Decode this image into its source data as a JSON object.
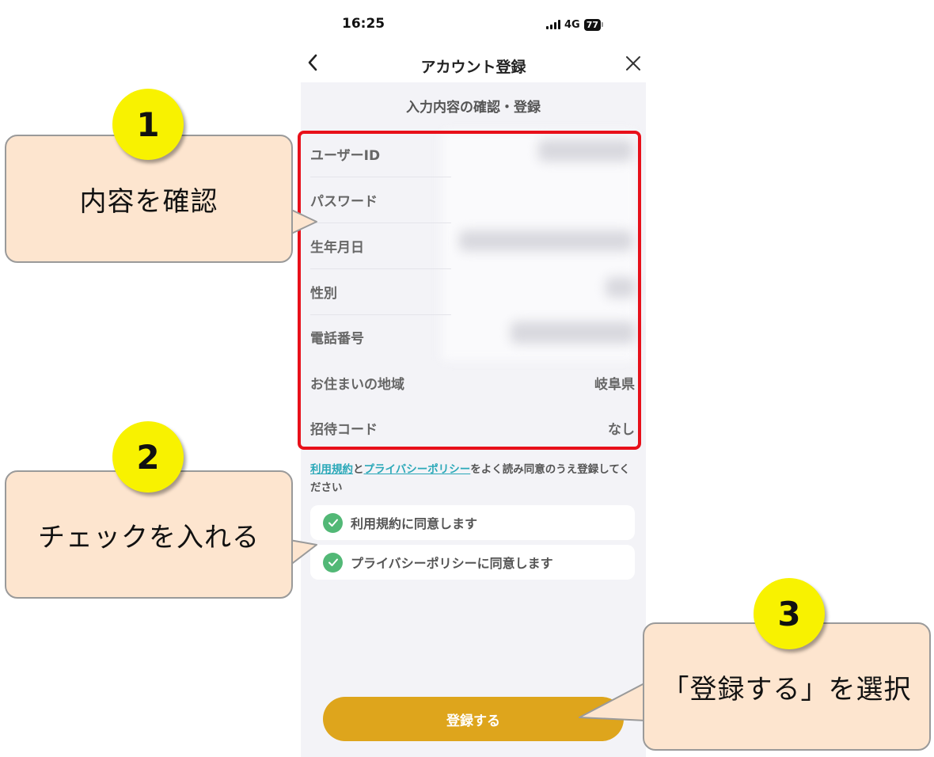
{
  "status_bar": {
    "time": "16:25",
    "network": "4G",
    "battery": "77"
  },
  "nav": {
    "title": "アカウント登録",
    "back_icon": "chevron-left-icon",
    "close_icon": "close-icon"
  },
  "screen": {
    "section_title": "入力内容の確認・登録",
    "info_rows": [
      {
        "label": "ユーザーID",
        "value": ""
      },
      {
        "label": "パスワード",
        "value": ""
      },
      {
        "label": "生年月日",
        "value": ""
      },
      {
        "label": "性別",
        "value": ""
      },
      {
        "label": "電話番号",
        "value": ""
      },
      {
        "label": "お住まいの地域",
        "value": "岐阜県"
      },
      {
        "label": "招待コード",
        "value": "なし"
      }
    ],
    "terms": {
      "link1": "利用規約",
      "joiner": "と",
      "link2": "プライバシーポリシー",
      "rest": "をよく読み同意のうえ登録してください"
    },
    "agreements": [
      {
        "label": "利用規約に同意します",
        "checked": true
      },
      {
        "label": "プライバシーポリシーに同意します",
        "checked": true
      }
    ],
    "register_button": "登録する"
  },
  "annotations": [
    {
      "number": "1",
      "text": "内容を確認"
    },
    {
      "number": "2",
      "text": "チェックを入れる"
    },
    {
      "number": "3",
      "text": "「登録する」を選択"
    }
  ],
  "colors": {
    "accent_button": "#dea51c",
    "check_green": "#52b876",
    "link": "#2aa8b8",
    "highlight_frame": "#e8101a",
    "callout_fill": "#fde5cf",
    "badge_yellow": "#f8f200"
  }
}
